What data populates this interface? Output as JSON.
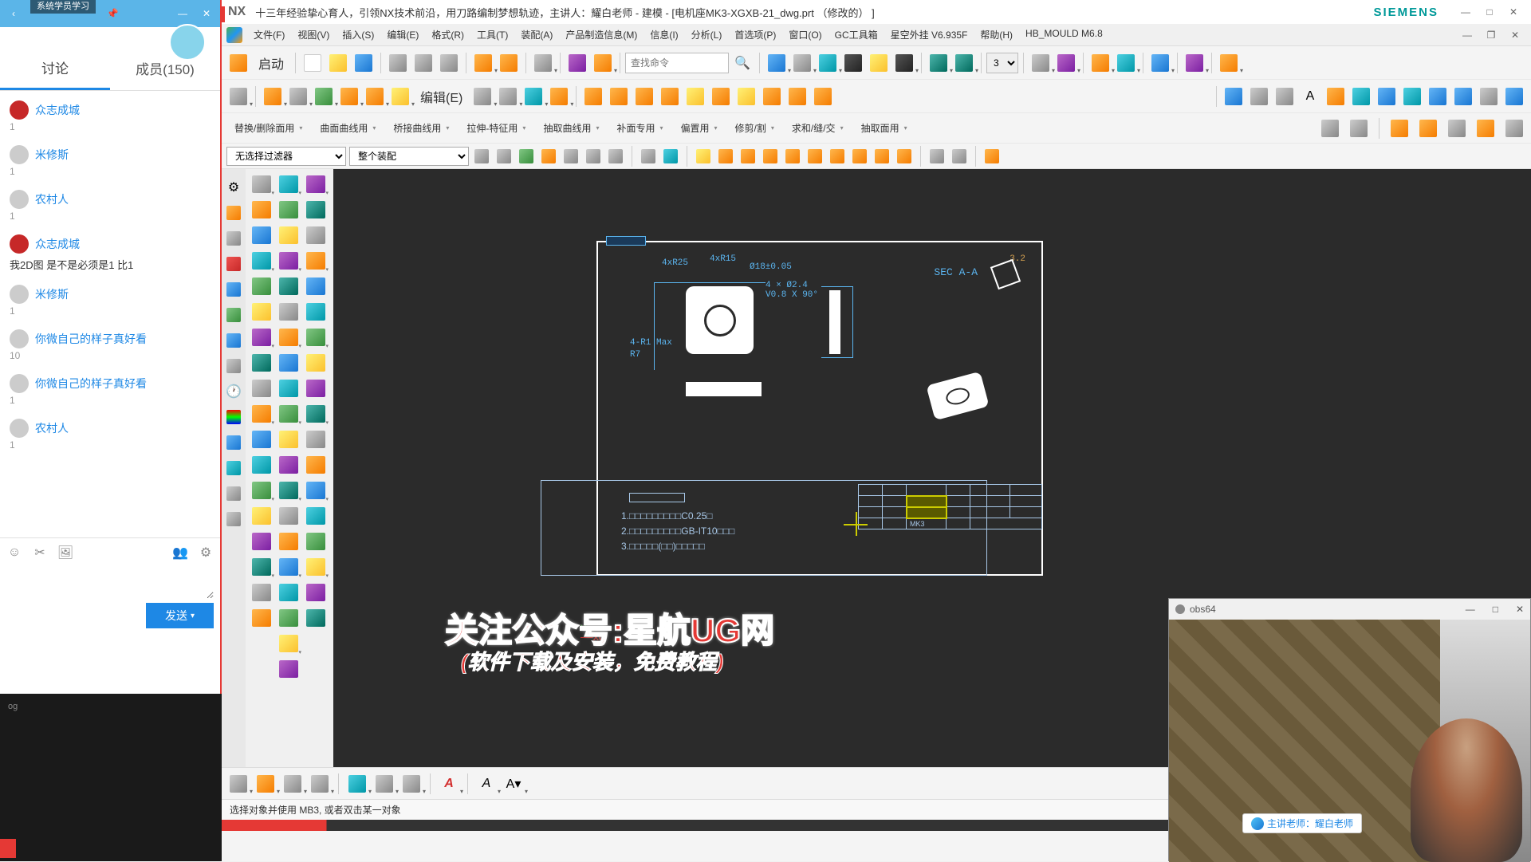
{
  "chat": {
    "sys_label": "系统学员学习",
    "tabs": {
      "discuss": "讨论",
      "members": "成员(150)"
    },
    "items": [
      {
        "name": "众志成城",
        "msg": "",
        "count": "1",
        "avatar": "red"
      },
      {
        "name": "米修斯",
        "msg": "",
        "count": "1",
        "avatar": "grey"
      },
      {
        "name": "农村人",
        "msg": "",
        "count": "1",
        "avatar": "grey"
      },
      {
        "name": "众志成城",
        "msg": "我2D图  是不是必须是1   比1",
        "count": "",
        "avatar": "red"
      },
      {
        "name": "米修斯",
        "msg": "",
        "count": "1",
        "avatar": "grey"
      },
      {
        "name": "你微自己的样子真好看",
        "msg": "",
        "count": "10",
        "avatar": "grey"
      },
      {
        "name": "你微自己的样子真好看",
        "msg": "",
        "count": "1",
        "avatar": "grey"
      },
      {
        "name": "农村人",
        "msg": "",
        "count": "1",
        "avatar": "grey"
      }
    ],
    "send": "发送",
    "bottom_text": "og"
  },
  "nx": {
    "logo": "NX",
    "title": "十三年经验挚心育人，引领NX技术前沿，用刀路编制梦想轨迹，主讲人：耀白老师 - 建模 - [电机座MK3-XGXB-21_dwg.prt （修改的） ]",
    "siemens": "SIEMENS",
    "menu": [
      "文件(F)",
      "视图(V)",
      "插入(S)",
      "编辑(E)",
      "格式(R)",
      "工具(T)",
      "装配(A)",
      "产品制造信息(M)",
      "信息(I)",
      "分析(L)",
      "首选项(P)",
      "窗口(O)",
      "GC工具箱",
      "星空外挂 V6.935F",
      "帮助(H)",
      "HB_MOULD M6.8"
    ],
    "start": "启动",
    "search_placeholder": "查找命令",
    "edit_btn": "编辑(E)",
    "filter1": "无选择过滤器",
    "filter2": "整个装配",
    "combo_val": "3",
    "toolbar3_items": [
      "替换/删除面用",
      "曲面曲线用",
      "桥接曲线用",
      "拉伸-特征用",
      "抽取曲线用",
      "补面专用",
      "偏置用",
      "修剪/割",
      "求和/缝/交",
      "抽取面用"
    ],
    "status": "选择对象并使用 MB3, 或者双击某一对象",
    "drawing": {
      "sec": "SEC A-A",
      "d1": "4xR25",
      "d2": "4xR15",
      "d3": "Ø18±0.05",
      "d4": "4 × Ø2.4",
      "d5": "V0.8 X 90°",
      "d6": "4-R1 Max",
      "d7": "R7",
      "d8": "3.2",
      "notes1": "1.□□□□□□□□□C0.25□",
      "notes2": "2.□□□□□□□□□GB-IT10□□□",
      "notes3": "3.□□□□□(□□)□□□□□",
      "tb_cell": "MK3"
    },
    "overlay1": "关注公众号:星航UG网",
    "overlay2": "(软件下载及安装，免费教程)"
  },
  "obs": {
    "title": "obs64",
    "teacher": "主讲老师：耀白老师"
  }
}
